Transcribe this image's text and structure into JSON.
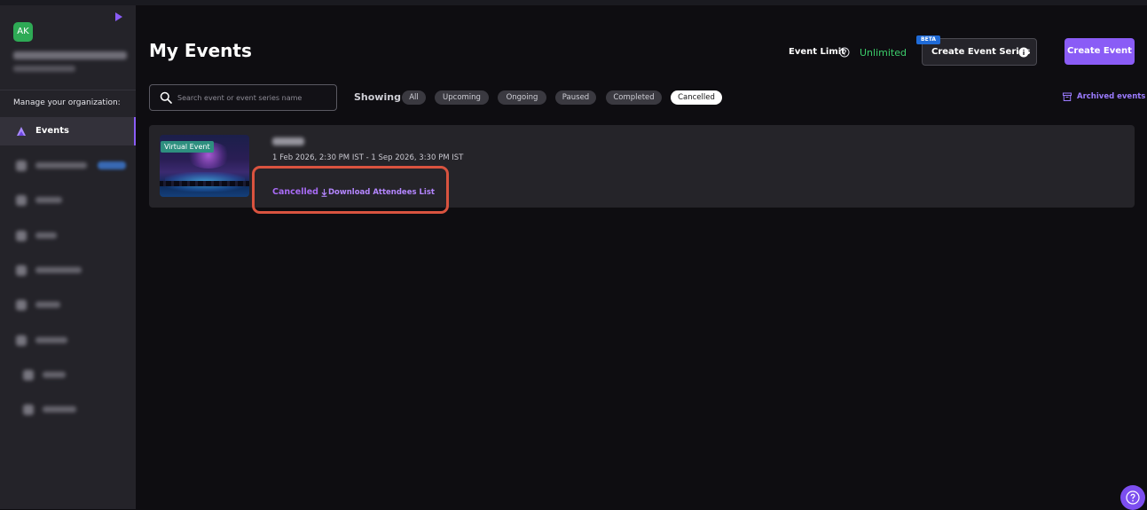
{
  "sidebar": {
    "avatar_initials": "AK",
    "manage_label": "Manage your organization:",
    "active_item": "Events"
  },
  "header": {
    "title": "My Events",
    "event_limit_label": "Event Limit",
    "event_limit_value": "Unlimited",
    "create_series_label": "Create Event Series",
    "beta_badge": "BETA",
    "create_event_label": "Create Event"
  },
  "filters": {
    "search_placeholder": "Search event or event series name",
    "showing_label": "Showing",
    "chips": [
      "All",
      "Upcoming",
      "Ongoing",
      "Paused",
      "Completed",
      "Cancelled"
    ],
    "selected": "Cancelled",
    "archived_label": "Archived events"
  },
  "events": [
    {
      "tag": "Virtual Event",
      "dates": "1 Feb 2026, 2:30 PM IST - 1 Sep 2026, 3:30 PM IST",
      "status": "Cancelled",
      "action": "Download Attendees List"
    }
  ],
  "colors": {
    "accent": "#8a5cf6",
    "unlimited": "#3ccd6b",
    "highlight": "#d9533f",
    "avatar": "#2eaa55"
  }
}
